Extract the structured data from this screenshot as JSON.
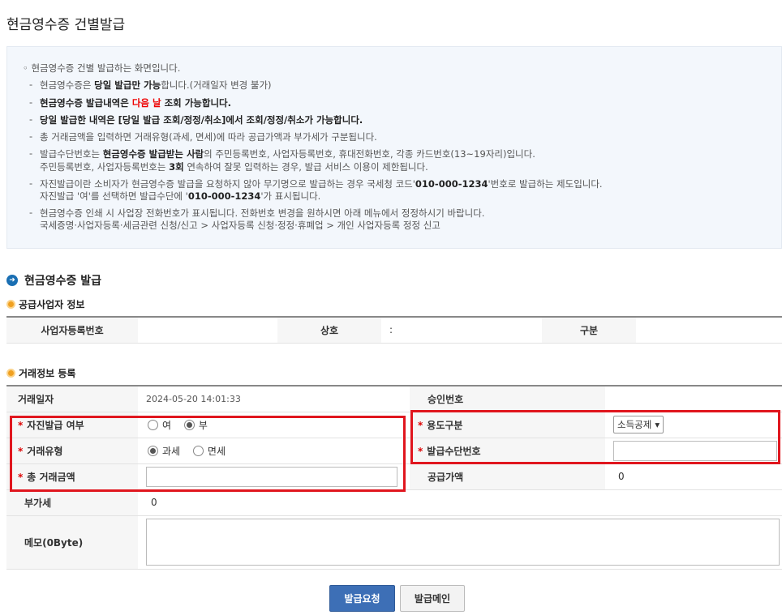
{
  "page_title": "현금영수증 건별발급",
  "info": {
    "intro": "현금영수증 건별 발급하는 화면입니다.",
    "line1_a": "현금영수증은 ",
    "line1_b": "당일 발급만 가능",
    "line1_c": "합니다.(거래일자 변경 불가)",
    "line2_a": "현금영수증 발급내역은 ",
    "line2_b": "다음 날",
    "line2_c": " 조회 가능합니다.",
    "line3": "당일 발급한 내역은 [당일 발급 조회/정정/취소]에서 조회/정정/취소가 가능합니다.",
    "line4": "총 거래금액을 입력하면 거래유형(과세, 면세)에 따라 공급가액과 부가세가 구분됩니다.",
    "line5_a": "발급수단번호는 ",
    "line5_b": "현금영수증 발급받는 사람",
    "line5_c": "의  주민등록번호, 사업자등록번호, 휴대전화번호, 각종 카드번호(13~19자리)입니다.",
    "line5_d": "주민등록번호, 사업자등록번호는 ",
    "line5_e": "3회",
    "line5_f": " 연속하여 잘못 입력하는 경우, 발급 서비스 이용이 제한됩니다.",
    "line6_a": "자진발급이란 소비자가 현금영수증 발급을 요청하지 않아 무기명으로 발급하는 경우 국세청 코드'",
    "line6_b": "010-000-1234",
    "line6_c": "'번호로 발급하는 제도입니다.",
    "line6_d": "자진발급 '여'를 선택하면 발급수단에 '",
    "line6_e": "010-000-1234",
    "line6_f": "'가 표시됩니다.",
    "line7": "현금영수증 인쇄 시 사업장 전화번호가 표시됩니다. 전화번호 변경을 원하시면 아래 메뉴에서 정정하시기 바랍니다.",
    "line7_b": "국세증명·사업자등록·세금관련 신청/신고 > 사업자등록 신청·정정·휴폐업 > 개인 사업자등록 정정 신고",
    "bullet": "◦",
    "dash": "-"
  },
  "section": {
    "title": "현금영수증 발급",
    "icon": "arrow-circle-icon"
  },
  "business": {
    "title": "공급사업자 정보",
    "reg_no_label": "사업자등록번호",
    "reg_no_value": "",
    "name_label": "상호",
    "name_value": ":",
    "type_label": "구분",
    "type_value": ""
  },
  "trade": {
    "title": "거래정보 등록",
    "date_label": "거래일자",
    "date_value": "2024-05-20 14:01:33",
    "approval_label": "승인번호",
    "approval_value": "",
    "self_issue_label": "자진발급 여부",
    "self_yes": "여",
    "self_no": "부",
    "self_selected": "부",
    "usage_label": "용도구분",
    "usage_value": "소득공제",
    "type_label": "거래유형",
    "type_tax": "과세",
    "type_free": "면세",
    "type_selected": "과세",
    "means_label": "발급수단번호",
    "means_value": "",
    "total_label": "총 거래금액",
    "total_value": "",
    "supply_label": "공급가액",
    "supply_value": "0",
    "vat_label": "부가세",
    "vat_value": "0",
    "memo_label": "메모(0Byte)",
    "memo_value": "",
    "required_mark": "*"
  },
  "buttons": {
    "request": "발급요청",
    "main": "발급메인"
  },
  "colors": {
    "highlight": "#e0161e",
    "primary_button": "#3d6fb6",
    "required": "#d00"
  }
}
